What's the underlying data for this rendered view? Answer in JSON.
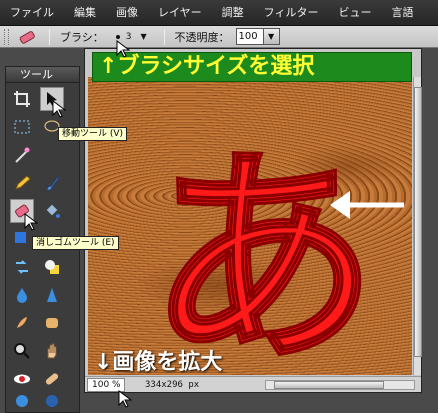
{
  "menu": [
    "ファイル",
    "編集",
    "画像",
    "レイヤー",
    "調整",
    "フィルター",
    "ビュー",
    "言語"
  ],
  "options_bar": {
    "brush_label": "ブラシ：",
    "brush_size": "3",
    "opacity_label": "不透明度：",
    "opacity_value": "100"
  },
  "toolbox": {
    "title": "ツール",
    "tools": [
      "crop-icon",
      "move-icon",
      "marquee-icon",
      "lasso-icon",
      "magic-wand-icon",
      "eyedropper-icon",
      "pencil-icon",
      "brush-icon",
      "eraser-icon",
      "paint-bucket-icon",
      "color-replace-icon",
      "shape-icon",
      "drop-icon",
      "sharpen-icon",
      "smudge-icon",
      "sponge-icon",
      "zoom-icon",
      "hand-icon",
      "eye-icon",
      "bandage-icon",
      "dodge-icon",
      "burn-icon"
    ],
    "move_tooltip": "移動ツール (V)",
    "eraser_tooltip": "消しゴムツール (E)"
  },
  "canvas": {
    "glyph": "あ",
    "zoom": "100 %",
    "doc_size": "334x296 px"
  },
  "annotations": {
    "brush_hint": "↑ブラシサイズを選択",
    "zoom_hint": "↓画像を拡大"
  },
  "colors": {
    "glyph_red": "#ff1a1a",
    "banner_green": "#1d8a1d",
    "banner_text": "#ffff33",
    "wood": "#a45e26"
  }
}
